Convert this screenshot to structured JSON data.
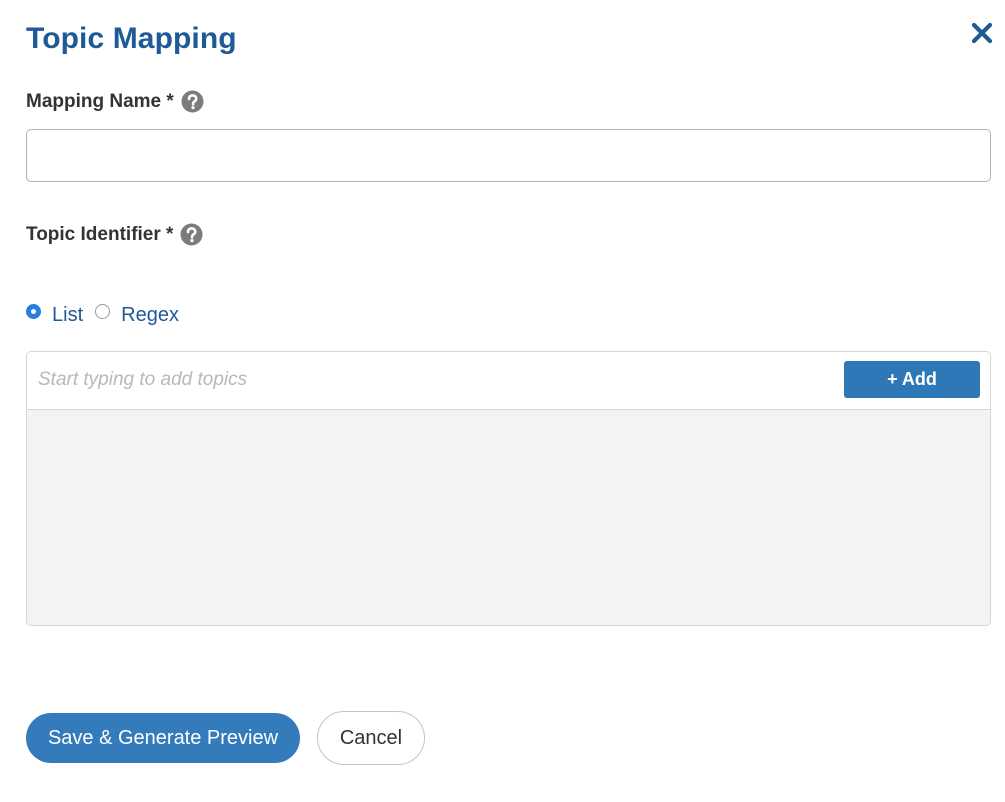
{
  "dialog": {
    "title": "Topic Mapping",
    "close_icon": "close-icon"
  },
  "mapping_name": {
    "label": "Mapping Name *",
    "help_icon": "question-circle-icon",
    "value": "",
    "placeholder": ""
  },
  "topic_identifier": {
    "label": "Topic Identifier *",
    "help_icon": "question-circle-icon",
    "mode_options": [
      {
        "label": "List",
        "selected": true
      },
      {
        "label": "Regex",
        "selected": false
      }
    ]
  },
  "topics": {
    "placeholder": "Start typing to add topics",
    "value": "",
    "add_label": "+ Add",
    "items": []
  },
  "footer": {
    "save_label": "Save & Generate Preview",
    "cancel_label": "Cancel"
  },
  "colors": {
    "title": "#1e5a96",
    "primary_button": "#347bbc",
    "add_button": "#2f78b7",
    "radio_selected": "#2a7de1",
    "list_background": "#f3f3f3"
  }
}
